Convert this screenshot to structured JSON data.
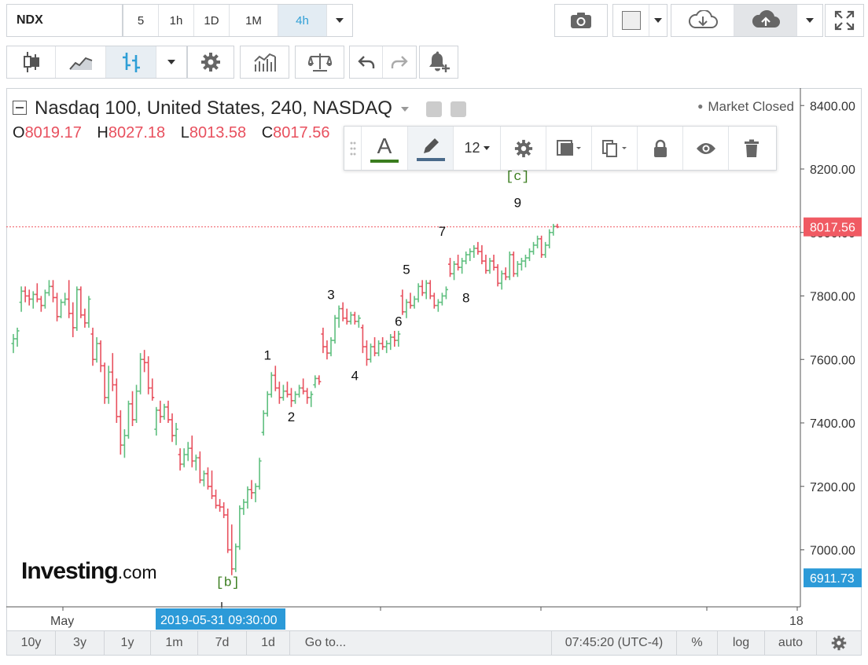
{
  "toolbar": {
    "symbol": "NDX",
    "intervals": [
      "5",
      "1h",
      "1D",
      "1M",
      "4h"
    ],
    "active_interval": "4h",
    "icons": [
      "camera-icon",
      "color-swatch-icon",
      "cloud-download-icon",
      "cloud-upload-icon",
      "fullscreen-icon",
      "candlestick-icon",
      "area-chart-icon",
      "bar-chart-icon",
      "gear-icon",
      "indicators-icon",
      "scale-icon",
      "undo-icon",
      "redo-icon",
      "alert-bell-icon"
    ]
  },
  "legend": {
    "title": "Nasdaq 100, United States, 240, NASDAQ",
    "open_label": "O",
    "open": "8019.17",
    "high_label": "H",
    "high": "8027.18",
    "low_label": "L",
    "low": "8013.58",
    "close_label": "C",
    "close": "8017.56",
    "status": "Market Closed"
  },
  "draw_toolbar": {
    "font_size": "12",
    "text_color": "#3a7d1e",
    "line_color": "#4a6a8a"
  },
  "logo": {
    "main": "Investing",
    "suffix": ".com"
  },
  "chart_data": {
    "type": "ohlc",
    "price_axis": {
      "ticks": [
        "8400.00",
        "8200.00",
        "8000.00",
        "7800.00",
        "7600.00",
        "7400.00",
        "7200.00",
        "7000.00"
      ],
      "current_price": "8017.56",
      "current_price_color": "#f05a63",
      "low_marker": "6911.73",
      "low_marker_color": "#2c9ad8",
      "range": [
        6860,
        8420
      ]
    },
    "time_axis": {
      "labels": [
        "May",
        "18"
      ],
      "crosshair_label": "2019-05-31 09:30:00"
    },
    "up_color": "#5fbf7f",
    "down_color": "#e8505e",
    "bars": [
      {
        "o": 7650,
        "h": 7680,
        "l": 7620,
        "c": 7665
      },
      {
        "o": 7665,
        "h": 7700,
        "l": 7640,
        "c": 7690
      },
      {
        "o": 7780,
        "h": 7830,
        "l": 7750,
        "c": 7815
      },
      {
        "o": 7815,
        "h": 7830,
        "l": 7780,
        "c": 7800
      },
      {
        "o": 7800,
        "h": 7820,
        "l": 7770,
        "c": 7790
      },
      {
        "o": 7790,
        "h": 7815,
        "l": 7760,
        "c": 7805
      },
      {
        "o": 7805,
        "h": 7840,
        "l": 7780,
        "c": 7790
      },
      {
        "o": 7790,
        "h": 7800,
        "l": 7750,
        "c": 7770
      },
      {
        "o": 7770,
        "h": 7820,
        "l": 7760,
        "c": 7810
      },
      {
        "o": 7810,
        "h": 7850,
        "l": 7800,
        "c": 7830
      },
      {
        "o": 7830,
        "h": 7850,
        "l": 7780,
        "c": 7795
      },
      {
        "o": 7795,
        "h": 7810,
        "l": 7720,
        "c": 7735
      },
      {
        "o": 7735,
        "h": 7790,
        "l": 7730,
        "c": 7780
      },
      {
        "o": 7780,
        "h": 7810,
        "l": 7770,
        "c": 7790
      },
      {
        "o": 7790,
        "h": 7850,
        "l": 7730,
        "c": 7745
      },
      {
        "o": 7745,
        "h": 7780,
        "l": 7670,
        "c": 7700
      },
      {
        "o": 7700,
        "h": 7830,
        "l": 7690,
        "c": 7820
      },
      {
        "o": 7820,
        "h": 7830,
        "l": 7730,
        "c": 7740
      },
      {
        "o": 7740,
        "h": 7760,
        "l": 7700,
        "c": 7715
      },
      {
        "o": 7715,
        "h": 7800,
        "l": 7700,
        "c": 7790
      },
      {
        "o": 7680,
        "h": 7700,
        "l": 7580,
        "c": 7600
      },
      {
        "o": 7600,
        "h": 7670,
        "l": 7590,
        "c": 7650
      },
      {
        "o": 7650,
        "h": 7660,
        "l": 7560,
        "c": 7580
      },
      {
        "o": 7580,
        "h": 7590,
        "l": 7460,
        "c": 7480
      },
      {
        "o": 7480,
        "h": 7580,
        "l": 7460,
        "c": 7560
      },
      {
        "o": 7560,
        "h": 7620,
        "l": 7500,
        "c": 7520
      },
      {
        "o": 7520,
        "h": 7540,
        "l": 7400,
        "c": 7420
      },
      {
        "o": 7420,
        "h": 7440,
        "l": 7300,
        "c": 7330
      },
      {
        "o": 7330,
        "h": 7380,
        "l": 7290,
        "c": 7360
      },
      {
        "o": 7360,
        "h": 7470,
        "l": 7350,
        "c": 7460
      },
      {
        "o": 7460,
        "h": 7500,
        "l": 7390,
        "c": 7410
      },
      {
        "o": 7410,
        "h": 7520,
        "l": 7400,
        "c": 7500
      },
      {
        "o": 7500,
        "h": 7620,
        "l": 7490,
        "c": 7600
      },
      {
        "o": 7600,
        "h": 7630,
        "l": 7560,
        "c": 7590
      },
      {
        "o": 7590,
        "h": 7610,
        "l": 7490,
        "c": 7510
      },
      {
        "o": 7510,
        "h": 7540,
        "l": 7470,
        "c": 7480
      },
      {
        "o": 7380,
        "h": 7450,
        "l": 7360,
        "c": 7440
      },
      {
        "o": 7440,
        "h": 7470,
        "l": 7400,
        "c": 7420
      },
      {
        "o": 7420,
        "h": 7460,
        "l": 7410,
        "c": 7450
      },
      {
        "o": 7450,
        "h": 7470,
        "l": 7400,
        "c": 7410
      },
      {
        "o": 7410,
        "h": 7430,
        "l": 7340,
        "c": 7360
      },
      {
        "o": 7360,
        "h": 7400,
        "l": 7330,
        "c": 7380
      },
      {
        "o": 7300,
        "h": 7320,
        "l": 7250,
        "c": 7270
      },
      {
        "o": 7270,
        "h": 7320,
        "l": 7260,
        "c": 7300
      },
      {
        "o": 7300,
        "h": 7340,
        "l": 7280,
        "c": 7320
      },
      {
        "o": 7320,
        "h": 7360,
        "l": 7260,
        "c": 7280
      },
      {
        "o": 7280,
        "h": 7300,
        "l": 7250,
        "c": 7290
      },
      {
        "o": 7290,
        "h": 7310,
        "l": 7210,
        "c": 7220
      },
      {
        "o": 7220,
        "h": 7250,
        "l": 7200,
        "c": 7240
      },
      {
        "o": 7240,
        "h": 7260,
        "l": 7190,
        "c": 7200
      },
      {
        "o": 7200,
        "h": 7250,
        "l": 7160,
        "c": 7170
      },
      {
        "o": 7170,
        "h": 7190,
        "l": 7130,
        "c": 7140
      },
      {
        "o": 7140,
        "h": 7160,
        "l": 7120,
        "c": 7135
      },
      {
        "o": 7135,
        "h": 7150,
        "l": 7100,
        "c": 7110
      },
      {
        "o": 7110,
        "h": 7130,
        "l": 6990,
        "c": 7000
      },
      {
        "o": 7000,
        "h": 7080,
        "l": 6920,
        "c": 6940
      },
      {
        "o": 6940,
        "h": 7020,
        "l": 6930,
        "c": 7010
      },
      {
        "o": 7010,
        "h": 7140,
        "l": 7000,
        "c": 7130
      },
      {
        "o": 7130,
        "h": 7160,
        "l": 7110,
        "c": 7150
      },
      {
        "o": 7150,
        "h": 7200,
        "l": 7130,
        "c": 7190
      },
      {
        "o": 7190,
        "h": 7220,
        "l": 7160,
        "c": 7180
      },
      {
        "o": 7180,
        "h": 7210,
        "l": 7150,
        "c": 7200
      },
      {
        "o": 7200,
        "h": 7290,
        "l": 7190,
        "c": 7280
      },
      {
        "o": 7370,
        "h": 7440,
        "l": 7360,
        "c": 7430
      },
      {
        "o": 7430,
        "h": 7500,
        "l": 7420,
        "c": 7490
      },
      {
        "o": 7490,
        "h": 7560,
        "l": 7480,
        "c": 7550
      },
      {
        "o": 7550,
        "h": 7580,
        "l": 7500,
        "c": 7510
      },
      {
        "o": 7510,
        "h": 7530,
        "l": 7460,
        "c": 7480
      },
      {
        "o": 7480,
        "h": 7520,
        "l": 7470,
        "c": 7500
      },
      {
        "o": 7500,
        "h": 7530,
        "l": 7480,
        "c": 7490
      },
      {
        "o": 7490,
        "h": 7510,
        "l": 7450,
        "c": 7470
      },
      {
        "o": 7470,
        "h": 7500,
        "l": 7460,
        "c": 7490
      },
      {
        "o": 7490,
        "h": 7520,
        "l": 7480,
        "c": 7510
      },
      {
        "o": 7510,
        "h": 7540,
        "l": 7490,
        "c": 7500
      },
      {
        "o": 7500,
        "h": 7510,
        "l": 7460,
        "c": 7480
      },
      {
        "o": 7480,
        "h": 7500,
        "l": 7450,
        "c": 7490
      },
      {
        "o": 7520,
        "h": 7550,
        "l": 7510,
        "c": 7540
      },
      {
        "o": 7540,
        "h": 7550,
        "l": 7520,
        "c": 7530
      },
      {
        "o": 7680,
        "h": 7700,
        "l": 7620,
        "c": 7640
      },
      {
        "o": 7640,
        "h": 7660,
        "l": 7600,
        "c": 7620
      },
      {
        "o": 7620,
        "h": 7670,
        "l": 7610,
        "c": 7660
      },
      {
        "o": 7660,
        "h": 7740,
        "l": 7650,
        "c": 7730
      },
      {
        "o": 7730,
        "h": 7770,
        "l": 7700,
        "c": 7760
      },
      {
        "o": 7760,
        "h": 7780,
        "l": 7720,
        "c": 7730
      },
      {
        "o": 7730,
        "h": 7760,
        "l": 7710,
        "c": 7720
      },
      {
        "o": 7720,
        "h": 7750,
        "l": 7710,
        "c": 7740
      },
      {
        "o": 7740,
        "h": 7750,
        "l": 7710,
        "c": 7720
      },
      {
        "o": 7720,
        "h": 7740,
        "l": 7700,
        "c": 7730
      },
      {
        "o": 7700,
        "h": 7710,
        "l": 7620,
        "c": 7640
      },
      {
        "o": 7640,
        "h": 7660,
        "l": 7580,
        "c": 7600
      },
      {
        "o": 7600,
        "h": 7650,
        "l": 7590,
        "c": 7640
      },
      {
        "o": 7640,
        "h": 7670,
        "l": 7610,
        "c": 7620
      },
      {
        "o": 7620,
        "h": 7660,
        "l": 7610,
        "c": 7650
      },
      {
        "o": 7650,
        "h": 7670,
        "l": 7630,
        "c": 7640
      },
      {
        "o": 7640,
        "h": 7660,
        "l": 7620,
        "c": 7650
      },
      {
        "o": 7650,
        "h": 7680,
        "l": 7630,
        "c": 7670
      },
      {
        "o": 7670,
        "h": 7690,
        "l": 7640,
        "c": 7660
      },
      {
        "o": 7660,
        "h": 7690,
        "l": 7640,
        "c": 7680
      },
      {
        "o": 7800,
        "h": 7820,
        "l": 7740,
        "c": 7750
      },
      {
        "o": 7750,
        "h": 7790,
        "l": 7730,
        "c": 7780
      },
      {
        "o": 7780,
        "h": 7810,
        "l": 7760,
        "c": 7770
      },
      {
        "o": 7770,
        "h": 7800,
        "l": 7760,
        "c": 7790
      },
      {
        "o": 7790,
        "h": 7840,
        "l": 7780,
        "c": 7830
      },
      {
        "o": 7830,
        "h": 7850,
        "l": 7800,
        "c": 7810
      },
      {
        "o": 7810,
        "h": 7850,
        "l": 7790,
        "c": 7840
      },
      {
        "o": 7840,
        "h": 7850,
        "l": 7790,
        "c": 7800
      },
      {
        "o": 7800,
        "h": 7810,
        "l": 7760,
        "c": 7770
      },
      {
        "o": 7770,
        "h": 7790,
        "l": 7750,
        "c": 7780
      },
      {
        "o": 7780,
        "h": 7810,
        "l": 7770,
        "c": 7800
      },
      {
        "o": 7800,
        "h": 7830,
        "l": 7790,
        "c": 7820
      },
      {
        "o": 7900,
        "h": 7920,
        "l": 7860,
        "c": 7870
      },
      {
        "o": 7870,
        "h": 7910,
        "l": 7850,
        "c": 7900
      },
      {
        "o": 7900,
        "h": 7930,
        "l": 7880,
        "c": 7890
      },
      {
        "o": 7890,
        "h": 7920,
        "l": 7870,
        "c": 7910
      },
      {
        "o": 7910,
        "h": 7940,
        "l": 7900,
        "c": 7930
      },
      {
        "o": 7930,
        "h": 7950,
        "l": 7910,
        "c": 7940
      },
      {
        "o": 7940,
        "h": 7960,
        "l": 7920,
        "c": 7950
      },
      {
        "o": 7950,
        "h": 7970,
        "l": 7930,
        "c": 7940
      },
      {
        "o": 7940,
        "h": 7960,
        "l": 7900,
        "c": 7910
      },
      {
        "o": 7910,
        "h": 7930,
        "l": 7870,
        "c": 7880
      },
      {
        "o": 7880,
        "h": 7920,
        "l": 7870,
        "c": 7910
      },
      {
        "o": 7910,
        "h": 7930,
        "l": 7880,
        "c": 7890
      },
      {
        "o": 7890,
        "h": 7900,
        "l": 7830,
        "c": 7840
      },
      {
        "o": 7840,
        "h": 7880,
        "l": 7820,
        "c": 7870
      },
      {
        "o": 7870,
        "h": 7890,
        "l": 7850,
        "c": 7860
      },
      {
        "o": 7860,
        "h": 7940,
        "l": 7850,
        "c": 7930
      },
      {
        "o": 7930,
        "h": 7940,
        "l": 7860,
        "c": 7870
      },
      {
        "o": 7870,
        "h": 7910,
        "l": 7860,
        "c": 7900
      },
      {
        "o": 7900,
        "h": 7920,
        "l": 7880,
        "c": 7910
      },
      {
        "o": 7910,
        "h": 7930,
        "l": 7890,
        "c": 7920
      },
      {
        "o": 7920,
        "h": 7950,
        "l": 7910,
        "c": 7940
      },
      {
        "o": 7940,
        "h": 7970,
        "l": 7930,
        "c": 7960
      },
      {
        "o": 7960,
        "h": 7990,
        "l": 7950,
        "c": 7980
      },
      {
        "o": 7980,
        "h": 7990,
        "l": 7920,
        "c": 7930
      },
      {
        "o": 7930,
        "h": 7970,
        "l": 7920,
        "c": 7960
      },
      {
        "o": 7960,
        "h": 8010,
        "l": 7950,
        "c": 8000
      },
      {
        "o": 8000,
        "h": 8027,
        "l": 7990,
        "c": 8019
      },
      {
        "o": 8019.17,
        "h": 8027.18,
        "l": 8013.58,
        "c": 8017.56
      }
    ],
    "wave_labels": [
      {
        "text": "[b]",
        "bar": 54,
        "price": 6935,
        "pos": "below",
        "color": "#3a7d1e",
        "mono": true
      },
      {
        "text": "1",
        "bar": 64,
        "price": 7580,
        "pos": "above",
        "color": "#111",
        "mono": false
      },
      {
        "text": "2",
        "bar": 70,
        "price": 7455,
        "pos": "below",
        "color": "#111",
        "mono": false
      },
      {
        "text": "3",
        "bar": 80,
        "price": 7770,
        "pos": "above",
        "color": "#111",
        "mono": false
      },
      {
        "text": "4",
        "bar": 86,
        "price": 7585,
        "pos": "below",
        "color": "#111",
        "mono": false
      },
      {
        "text": "5",
        "bar": 99,
        "price": 7850,
        "pos": "above",
        "color": "#111",
        "mono": false
      },
      {
        "text": "6",
        "bar": 97,
        "price": 7755,
        "pos": "below",
        "color": "#111",
        "mono": false
      },
      {
        "text": "7",
        "bar": 108,
        "price": 7970,
        "pos": "above",
        "color": "#111",
        "mono": false
      },
      {
        "text": "8",
        "bar": 114,
        "price": 7830,
        "pos": "below",
        "color": "#111",
        "mono": false
      },
      {
        "text": "9",
        "bar": 127,
        "price": 8060,
        "pos": "above",
        "color": "#111",
        "mono": false
      },
      {
        "text": "[c]",
        "bar": 127,
        "price": 8145,
        "pos": "above",
        "color": "#3a7d1e",
        "mono": true
      }
    ]
  },
  "bottom_bar": {
    "ranges": [
      "10y",
      "3y",
      "1y",
      "1m",
      "7d",
      "1d"
    ],
    "goto": "Go to...",
    "clock": "07:45:20 (UTC-4)",
    "percent": "%",
    "log": "log",
    "auto": "auto"
  }
}
